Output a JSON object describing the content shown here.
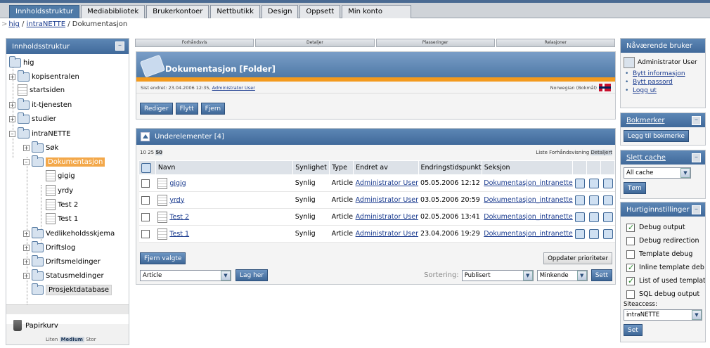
{
  "tabs": [
    "Innholdsstruktur",
    "Mediabibliotek",
    "Brukerkontoer",
    "Nettbutikk",
    "Design",
    "Oppsett",
    "Min konto"
  ],
  "breadcrumb": {
    "arrow": ">",
    "parts": [
      "hig",
      "intraNETTE"
    ],
    "sep": "/",
    "current": "Dokumentasjon"
  },
  "left": {
    "title": "Innholdsstruktur",
    "tree": [
      "hig",
      "kopisentralen",
      "startsiden",
      "it-tjenesten",
      "studier",
      "intraNETTE",
      "Søk",
      "Dokumentasjon",
      "gigig",
      "yrdy",
      "Test 2",
      "Test 1",
      "Vedlikeholdsskjema",
      "Driftslog",
      "Driftsmeldinger",
      "Statusmeldinger",
      "Prosjektdatabase"
    ],
    "trash": "Papirkurv",
    "sizes": [
      "Liten",
      "Medium",
      "Stor"
    ]
  },
  "center": {
    "columns": [
      "Forhåndsvis",
      "Detaljer",
      "Plasseringer",
      "Relasjoner"
    ],
    "folder_title": "Dokumentasjon [Folder]",
    "modified_text": "Sist endret: 23.04.2006 12:35,",
    "modified_user": "Administrator User",
    "language": "Norwegian (Bokmål)",
    "buttons": [
      "Rediger",
      "Flytt",
      "Fjern"
    ],
    "sub_title": "Underelementer [4]",
    "pager": [
      "10",
      "25",
      "50"
    ],
    "views": [
      "Liste",
      "Forhåndsvisning",
      "Detaljert"
    ],
    "table_headers": [
      "Navn",
      "Synlighet",
      "Type",
      "Endret av",
      "Endringstidspunkt",
      "Seksjon"
    ],
    "rows": [
      {
        "name": "gigig",
        "vis": "Synlig",
        "type": "Article",
        "user": "Administrator User",
        "time": "05.05.2006 12:12",
        "section": "Dokumentasjon_intranette"
      },
      {
        "name": "yrdy",
        "vis": "Synlig",
        "type": "Article",
        "user": "Administrator User",
        "time": "03.05.2006 20:59",
        "section": "Dokumentasjon_intranette"
      },
      {
        "name": "Test 2",
        "vis": "Synlig",
        "type": "Article",
        "user": "Administrator User",
        "time": "02.05.2006 13:41",
        "section": "Dokumentasjon_intranette"
      },
      {
        "name": "Test 1",
        "vis": "Synlig",
        "type": "Article",
        "user": "Administrator User",
        "time": "23.04.2006 19:29",
        "section": "Dokumentasjon_intranette"
      }
    ],
    "remove_selected": "Fjern valgte",
    "update_priorities": "Oppdater prioriteter",
    "class_select": "Article",
    "create_here": "Lag her",
    "sort_label": "Sortering:",
    "sort_field": "Publisert",
    "sort_order": "Minkende",
    "set": "Sett"
  },
  "right": {
    "user_title": "Nåværende bruker",
    "user_name": "Administrator User",
    "user_links": [
      "Bytt informasjon",
      "Bytt passord",
      "Logg ut"
    ],
    "bookmarks_title": "Bokmerker",
    "bookmark_btn": "Legg til bokmerke",
    "cache_title": "Slett cache",
    "cache_select": "All cache",
    "cache_btn": "Tøm",
    "settings_title": "Hurtiginnstillinger",
    "settings": [
      {
        "label": "Debug output",
        "checked": true
      },
      {
        "label": "Debug redirection",
        "checked": false
      },
      {
        "label": "Template debug",
        "checked": false
      },
      {
        "label": "Inline template deb",
        "checked": true
      },
      {
        "label": "List of used templat",
        "checked": true
      },
      {
        "label": "SQL debug output",
        "checked": false
      }
    ],
    "siteaccess_label": "Siteaccess:",
    "siteaccess_value": "intraNETTE",
    "set_btn": "Set"
  }
}
